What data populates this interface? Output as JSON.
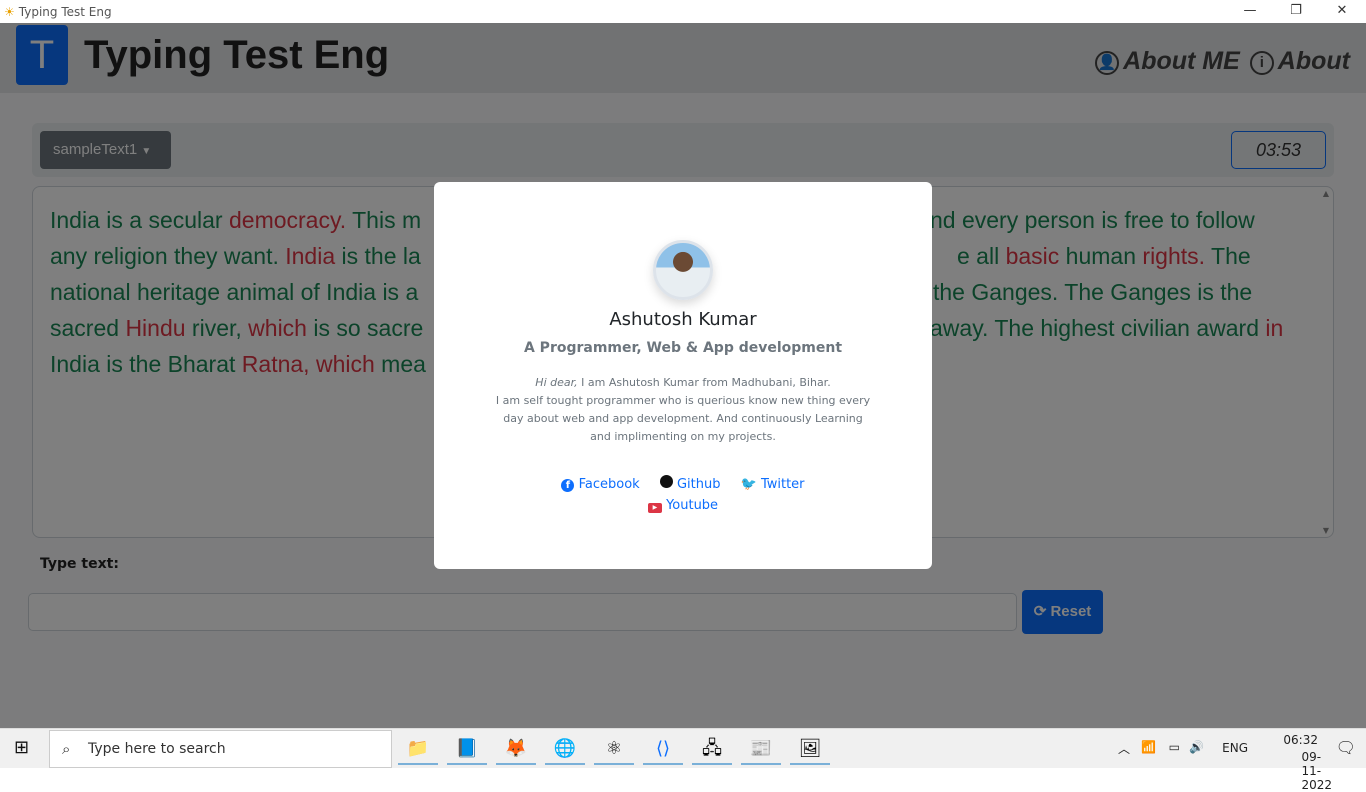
{
  "window": {
    "title": "Typing Test Eng",
    "minimize": "—",
    "restore": "❐",
    "close": "✕"
  },
  "header": {
    "logo_letter": "T",
    "brand": "Typing Test Eng",
    "about_me": "About ME",
    "about": "About"
  },
  "toolbar": {
    "sample_select": "sampleText1",
    "timer": "03:53"
  },
  "passage": {
    "lines": [
      {
        "left": [
          [
            "India is a secular ",
            "g"
          ],
          [
            "democracy.",
            "r"
          ],
          [
            " This m",
            "g"
          ]
        ],
        "right": [
          [
            "nd every person is free to follow",
            "g"
          ]
        ]
      },
      {
        "left": [
          [
            "any religion they want. ",
            "g"
          ],
          [
            "India",
            "r"
          ],
          [
            " is the la",
            "g"
          ]
        ],
        "right": [
          [
            "e all ",
            "g"
          ],
          [
            "basic",
            "r"
          ],
          [
            " human ",
            "g"
          ],
          [
            "rights.",
            "r"
          ],
          [
            " The",
            "g"
          ]
        ]
      },
      {
        "left": [
          [
            "national heritage animal of India is a",
            "g"
          ]
        ],
        "right": [
          [
            "the Ganges. The Ganges is the",
            "g"
          ]
        ]
      },
      {
        "left": [
          [
            "sacred ",
            "g"
          ],
          [
            "Hindu",
            "r"
          ],
          [
            " river, ",
            "g"
          ],
          [
            "which",
            "r"
          ],
          [
            " is so sacre",
            "g"
          ]
        ],
        "right": [
          [
            "away. The highest civilian award ",
            "g"
          ],
          [
            "in",
            "r"
          ]
        ]
      },
      {
        "left": [
          [
            "India is the Bharat ",
            "g"
          ],
          [
            "Ratna,",
            "r"
          ],
          [
            " ",
            "g"
          ],
          [
            "which",
            "r"
          ],
          [
            " mea",
            "g"
          ]
        ],
        "right": []
      }
    ]
  },
  "input": {
    "label": "Type text:",
    "value": "",
    "reset": "Reset"
  },
  "modal": {
    "name": "Ashutosh Kumar",
    "subtitle": "A Programmer, Web & App development",
    "greeting": "Hi dear,",
    "bio_line1": " I am Ashutosh Kumar from Madhubani, Bihar.",
    "bio_rest": "I am self tought programmer who is querious know new thing every day about web and app development. And continuously Learning and implimenting on my projects.",
    "links": {
      "facebook": "Facebook",
      "github": "Github",
      "twitter": "Twitter",
      "youtube": "Youtube"
    }
  },
  "taskbar": {
    "search_placeholder": "Type here to search",
    "language": "ENG",
    "time": "06:32",
    "date": "09-11-2022"
  },
  "colors": {
    "primary": "#0d6efd",
    "correct": "#198754",
    "wrong": "#dc3545"
  }
}
